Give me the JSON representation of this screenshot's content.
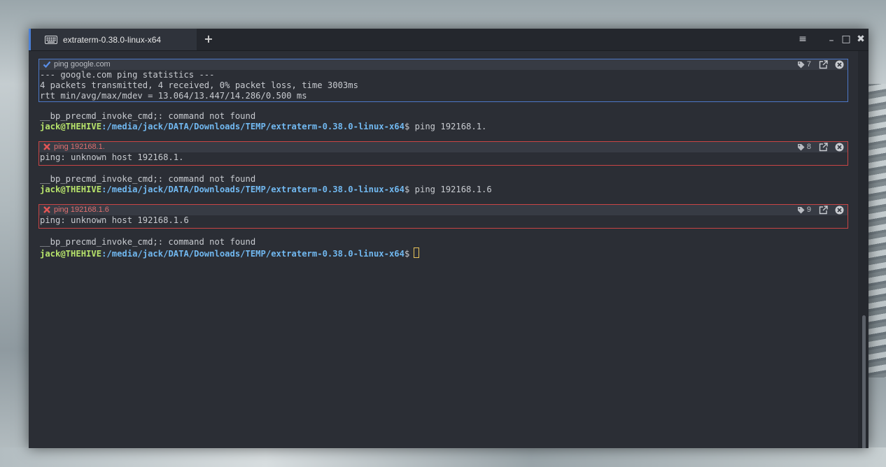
{
  "window": {
    "tab_title": "extraterm-0.38.0-linux-x64",
    "new_tab_symbol": "+",
    "menu_symbol": "≡",
    "minimize_symbol": "–",
    "maximize_symbol": "□",
    "close_symbol": "✖"
  },
  "terminal": {
    "blocks": [
      {
        "command": "ping google.com",
        "status": "success",
        "tag_number": "7",
        "output": [
          "--- google.com ping statistics ---",
          "4 packets transmitted, 4 received, 0% packet loss, time 3003ms",
          "rtt min/avg/max/mdev = 13.064/13.447/14.286/0.500 ms"
        ]
      },
      {
        "command": "ping 192168.1.",
        "status": "error",
        "tag_number": "8",
        "output": [
          "ping: unknown host 192168.1."
        ]
      },
      {
        "command": "ping 192168.1.6",
        "status": "error",
        "tag_number": "9",
        "output": [
          "ping: unknown host 192168.1.6"
        ]
      }
    ],
    "error_line": "__bp_precmd_invoke_cmd;: command not found",
    "prompt": {
      "user": "jack@THEHIVE",
      "path": ":/media/jack/DATA/Downloads/TEMP/extraterm-0.38.0-linux-x64",
      "symbol": "$"
    },
    "prompt_commands": [
      "ping 192168.1.",
      "ping 192168.1.6",
      ""
    ]
  },
  "colors": {
    "success_border": "#4d78c8",
    "error_border": "#c94545",
    "prompt_user": "#b7e36b",
    "prompt_path": "#71b8f0",
    "cursor": "#e8c35a"
  }
}
